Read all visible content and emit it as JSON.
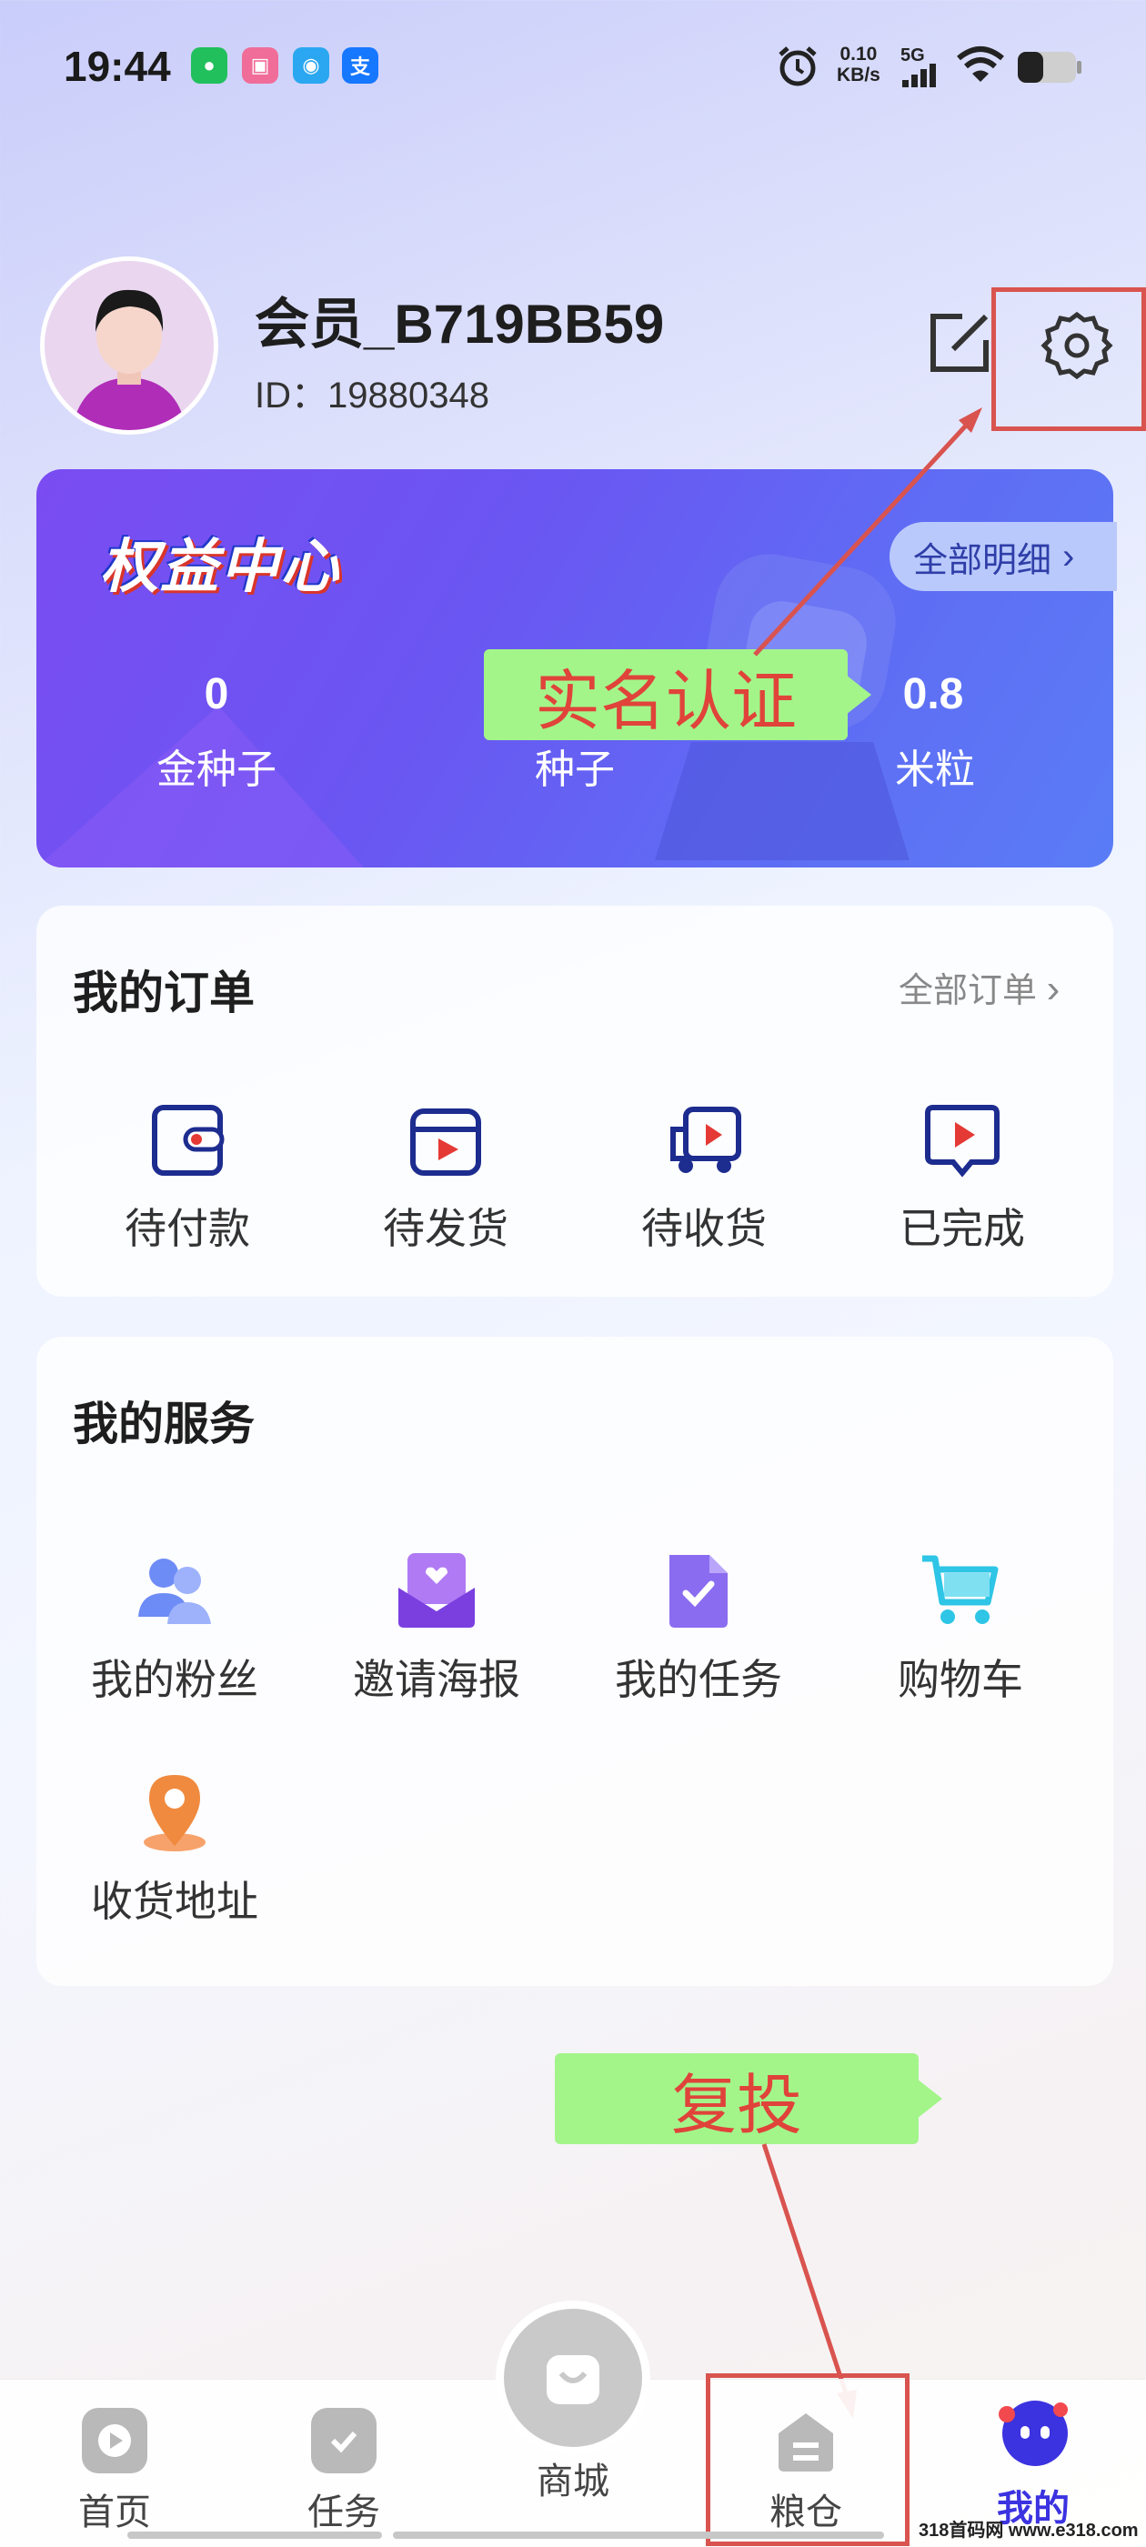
{
  "status_bar": {
    "time": "19:44",
    "net_speed_value": "0.10",
    "net_speed_unit": "KB/s",
    "signal": "5G"
  },
  "profile": {
    "username": "会员_B719BB59",
    "id_text": "ID：19880348"
  },
  "benefits": {
    "title": "权益中心",
    "detail_label": "全部明细",
    "stats": [
      {
        "value": "0",
        "label": "金种子"
      },
      {
        "value": "",
        "label": "种子"
      },
      {
        "value": "0.8",
        "label": "米粒"
      }
    ]
  },
  "annotations": {
    "verify": "实名认证",
    "reinvest": "复投"
  },
  "orders": {
    "title": "我的订单",
    "more_label": "全部订单",
    "items": [
      {
        "label": "待付款",
        "icon": "wallet-icon"
      },
      {
        "label": "待发货",
        "icon": "box-icon"
      },
      {
        "label": "待收货",
        "icon": "truck-icon"
      },
      {
        "label": "已完成",
        "icon": "check-done-icon"
      }
    ]
  },
  "services": {
    "title": "我的服务",
    "items": [
      {
        "label": "我的粉丝",
        "icon": "fans-icon"
      },
      {
        "label": "邀请海报",
        "icon": "invite-poster-icon"
      },
      {
        "label": "我的任务",
        "icon": "task-doc-icon"
      },
      {
        "label": "购物车",
        "icon": "cart-icon"
      },
      {
        "label": "收货地址",
        "icon": "location-icon"
      }
    ]
  },
  "tabbar": {
    "items": [
      {
        "label": "首页",
        "active": false
      },
      {
        "label": "任务",
        "active": false
      },
      {
        "label": "商城",
        "active": false
      },
      {
        "label": "粮仓",
        "active": false
      },
      {
        "label": "我的",
        "active": true
      }
    ]
  },
  "watermark": "318首码网 www.e318.com",
  "colors": {
    "accent": "#3b32e0",
    "callout_bg": "#a3f58a",
    "callout_text": "#e0433a",
    "highlight_box": "#d9534f"
  }
}
